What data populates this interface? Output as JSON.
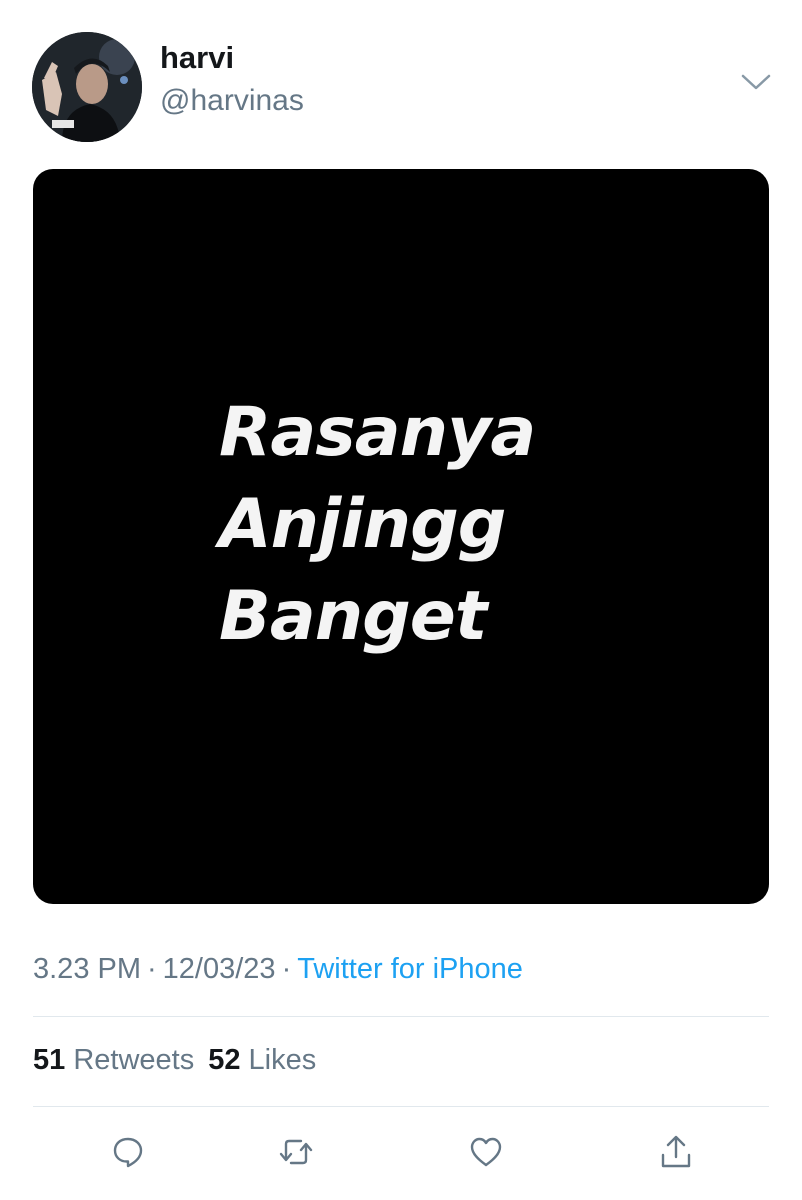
{
  "tweet": {
    "author": {
      "display_name": "harvi",
      "handle": "@harvinas",
      "avatar_icon": "profile-photo"
    },
    "menu_icon": "chevron-down-icon",
    "media": {
      "lines": [
        "Rasanya",
        "Anjingg",
        "Banget"
      ]
    },
    "meta": {
      "time": "3.23 PM",
      "separator": "·",
      "date": "12/03/23",
      "source": "Twitter for iPhone"
    },
    "stats": {
      "retweets_count": "51",
      "retweets_label": "Retweets",
      "likes_count": "52",
      "likes_label": "Likes"
    },
    "actions": [
      {
        "name": "reply",
        "icon": "reply-icon"
      },
      {
        "name": "retweet",
        "icon": "retweet-icon"
      },
      {
        "name": "like",
        "icon": "heart-icon"
      },
      {
        "name": "share",
        "icon": "share-icon"
      }
    ]
  },
  "colors": {
    "primary_text": "#14171a",
    "secondary_text": "#657786",
    "link": "#1da1f2",
    "divider": "#e1e8ed",
    "icon": "#657786"
  }
}
